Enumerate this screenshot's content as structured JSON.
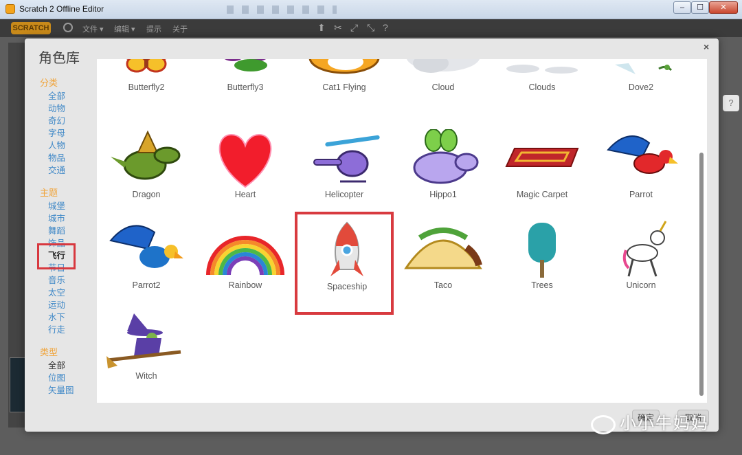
{
  "window": {
    "title": "Scratch 2 Offline Editor",
    "minimize": "–",
    "maximize": "☐",
    "close": "✕"
  },
  "menubar": {
    "logo": "SCRATCH",
    "items": [
      "文件 ▾",
      "编辑 ▾",
      "提示",
      "关于"
    ]
  },
  "dialog": {
    "title": "角色库",
    "close": "×",
    "categories": {
      "title": "分类",
      "items": [
        "全部",
        "动物",
        "奇幻",
        "字母",
        "人物",
        "物品",
        "交通"
      ]
    },
    "themes": {
      "title": "主题",
      "items": [
        "城堡",
        "城市",
        "舞蹈",
        "饰品",
        "飞行",
        "节日",
        "音乐",
        "太空",
        "运动",
        "水下",
        "行走"
      ],
      "selected": "飞行"
    },
    "types": {
      "title": "类型",
      "items": [
        "全部",
        "位图",
        "矢量图"
      ],
      "active": "全部"
    },
    "sprites": [
      {
        "name": "Butterfly2",
        "icon": "butterfly-orange"
      },
      {
        "name": "Butterfly3",
        "icon": "butterfly-purple"
      },
      {
        "name": "Cat1 Flying",
        "icon": "cat-flying"
      },
      {
        "name": "Cloud",
        "icon": "cloud"
      },
      {
        "name": "Clouds",
        "icon": "clouds"
      },
      {
        "name": "Dove2",
        "icon": "dove"
      },
      {
        "name": "Dragon",
        "icon": "dragon"
      },
      {
        "name": "Heart",
        "icon": "heart"
      },
      {
        "name": "Helicopter",
        "icon": "helicopter"
      },
      {
        "name": "Hippo1",
        "icon": "hippo"
      },
      {
        "name": "Magic Carpet",
        "icon": "carpet"
      },
      {
        "name": "Parrot",
        "icon": "parrot"
      },
      {
        "name": "Parrot2",
        "icon": "parrot"
      },
      {
        "name": "Rainbow",
        "icon": "rainbow"
      },
      {
        "name": "Spaceship",
        "icon": "rocket"
      },
      {
        "name": "Taco",
        "icon": "taco"
      },
      {
        "name": "Trees",
        "icon": "tree"
      },
      {
        "name": "Unicorn",
        "icon": "unicorn"
      },
      {
        "name": "Witch",
        "icon": "witch"
      }
    ],
    "footer": {
      "ok": "确定",
      "cancel": "取消"
    }
  },
  "watermark": "小小牛妈妈",
  "colors": {
    "highlight": "#d83a3f",
    "category_title": "#f0a43a",
    "link": "#3f88c7"
  }
}
